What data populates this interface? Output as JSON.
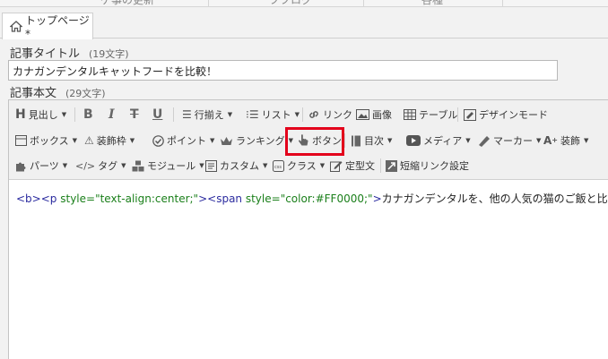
{
  "topnav": {
    "items": [
      "ゲ事の更新",
      "ブブログ",
      "各種"
    ]
  },
  "tab": {
    "label": "トップページ*"
  },
  "article_title": {
    "label": "記事タイトル",
    "count": "(19文字)",
    "value": "カナガンデンタルキャットフードを比較！"
  },
  "article_body": {
    "label": "記事本文",
    "count": "(29文字)"
  },
  "toolbar": {
    "row1": {
      "heading": "見出し",
      "bold": "B",
      "italic": "I",
      "strike": "T",
      "underline": "U",
      "align": "行揃え",
      "list": "リスト",
      "link": "リンク",
      "image": "画像",
      "table": "テーブル",
      "design": "デザインモード"
    },
    "row2": {
      "box": "ボックス",
      "decor_frame": "装飾枠",
      "point": "ポイント",
      "ranking": "ランキング",
      "button": "ボタン",
      "toc": "目次",
      "media": "メディア",
      "marker": "マーカー",
      "decoration": "装飾"
    },
    "row3": {
      "parts": "パーツ",
      "tag": "タグ",
      "module": "モジュール",
      "custom": "カスタム",
      "class": "クラス",
      "template": "定型文",
      "short_link": "短縮リンク設定"
    }
  },
  "code": {
    "t1": "<b>",
    "t2": "<p ",
    "a1": "style=",
    "s1": "\"text-align:center;\"",
    "t3": ">",
    "t4": "<span ",
    "a2": "style=",
    "s2": "\"color:#FF0000;\"",
    "t5": ">",
    "text": "カナガンデンタルを、他の人気の猫のご飯と比較してみま"
  },
  "colors": {
    "highlight": "#e3001b",
    "tag": "#2b2b9f",
    "string": "#1a7f1a"
  }
}
